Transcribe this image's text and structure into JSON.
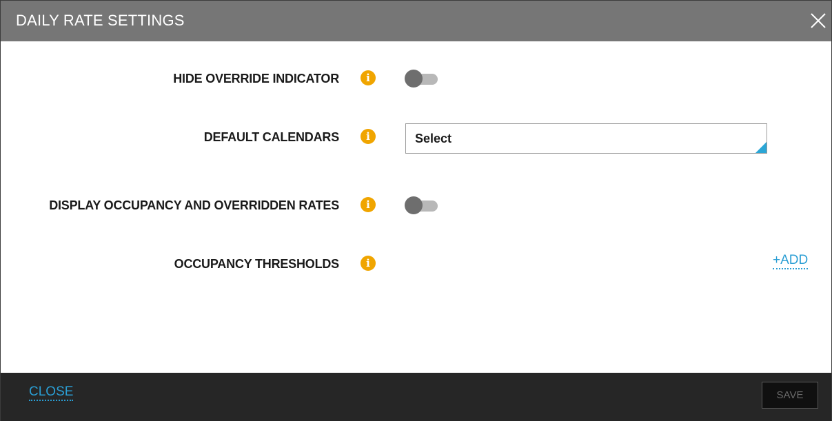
{
  "dialog": {
    "title": "DAILY RATE SETTINGS",
    "close_icon": "close-icon"
  },
  "settings": {
    "hide_override_indicator": {
      "label": "HIDE OVERRIDE INDICATOR",
      "info_icon": "info-icon",
      "enabled": false
    },
    "default_calendars": {
      "label": "DEFAULT CALENDARS",
      "info_icon": "info-icon",
      "value": "Select"
    },
    "display_occupancy": {
      "label": "DISPLAY OCCUPANCY AND OVERRIDDEN RATES",
      "info_icon": "info-icon",
      "enabled": false
    },
    "occupancy_thresholds": {
      "label": "OCCUPANCY THRESHOLDS",
      "info_icon": "info-icon",
      "add_label": "+ADD"
    }
  },
  "footer": {
    "close_label": "CLOSE",
    "save_label": "SAVE"
  },
  "colors": {
    "header_bg": "#767676",
    "footer_bg": "#262626",
    "accent": "#2a9ed4",
    "info": "#f0a500"
  }
}
